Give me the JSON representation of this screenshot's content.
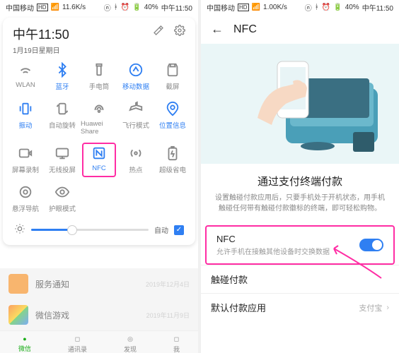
{
  "left": {
    "statusbar": {
      "carrier": "中国移动",
      "speed": "11.6K/s",
      "battery": "40%",
      "time": "中午11:50"
    },
    "panel": {
      "time": "中午11:50",
      "date": "1月19日星期日",
      "tiles": [
        {
          "name": "wlan",
          "label": "WLAN",
          "active": false
        },
        {
          "name": "bluetooth",
          "label": "蓝牙",
          "active": true
        },
        {
          "name": "flashlight",
          "label": "手电筒",
          "active": false
        },
        {
          "name": "mobile-data",
          "label": "移动数据",
          "active": true
        },
        {
          "name": "screenshot",
          "label": "截屏",
          "active": false
        },
        {
          "name": "vibrate",
          "label": "振动",
          "active": true
        },
        {
          "name": "auto-rotate",
          "label": "自动旋转",
          "active": false
        },
        {
          "name": "huawei-share",
          "label": "Huawei Share",
          "active": false
        },
        {
          "name": "airplane",
          "label": "飞行模式",
          "active": false
        },
        {
          "name": "location",
          "label": "位置信息",
          "active": true
        },
        {
          "name": "screen-record",
          "label": "屏幕录制",
          "active": false
        },
        {
          "name": "wireless-proj",
          "label": "无线投屏",
          "active": false
        },
        {
          "name": "nfc",
          "label": "NFC",
          "active": true,
          "highlight": true
        },
        {
          "name": "hotspot",
          "label": "热点",
          "active": false
        },
        {
          "name": "super-save",
          "label": "超级省电",
          "active": false
        },
        {
          "name": "float-nav",
          "label": "悬浮导航",
          "active": false
        },
        {
          "name": "eye-comfort",
          "label": "护眼模式",
          "active": false
        }
      ],
      "brightness": {
        "auto_label": "自动",
        "checked": true
      }
    },
    "behind": {
      "row1": {
        "title": "服务通知",
        "date": "2019年12月4日"
      },
      "row2": {
        "title": "微信游戏",
        "date": "2019年11月9日"
      },
      "nav": [
        "微信",
        "通讯录",
        "发现",
        "我"
      ]
    }
  },
  "right": {
    "statusbar": {
      "carrier": "中国移动",
      "speed": "1.00K/s",
      "battery": "40%",
      "time": "中午11:50"
    },
    "title": "NFC",
    "section": {
      "heading": "通过支付终端付款",
      "desc": "设置触碰付款应用后，只要手机处于开机状态，用手机触碰任何带有触碰付款徽标的终端，即可轻松购物。"
    },
    "nfc_toggle": {
      "title": "NFC",
      "sub": "允许手机在接触其他设备时交换数据"
    },
    "tap_pay": {
      "title": "触碰付款"
    },
    "default_app": {
      "title": "默认付款应用",
      "value": "支付宝"
    }
  }
}
